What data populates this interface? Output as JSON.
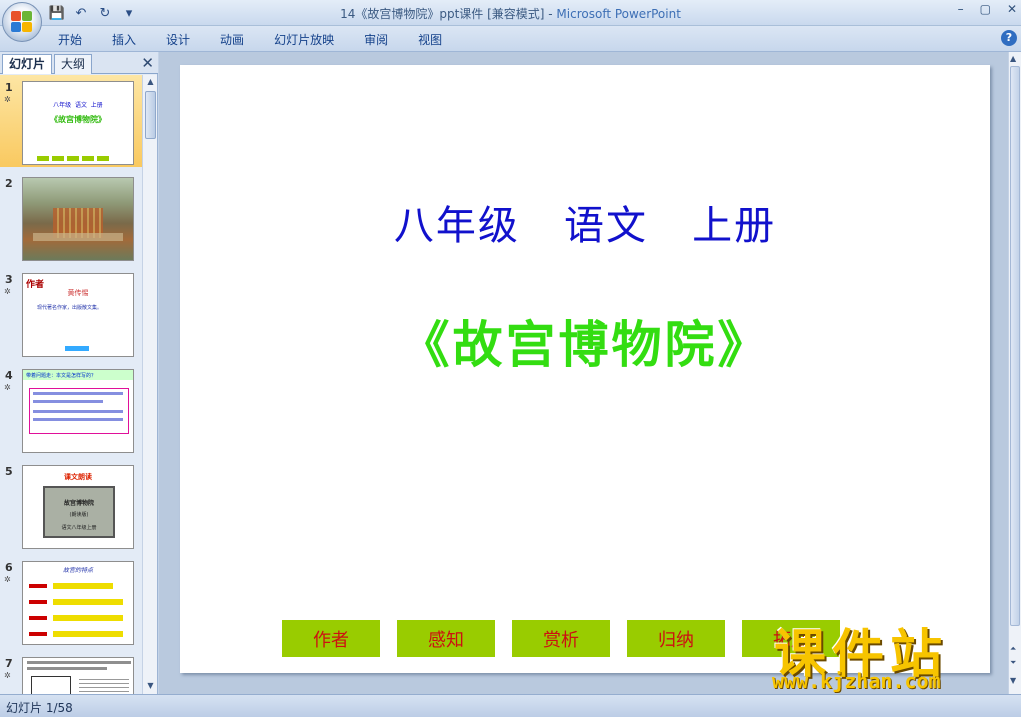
{
  "window": {
    "title": "14《故宫博物院》ppt课件 [兼容模式] - ",
    "app_name": "Microsoft PowerPoint",
    "minimize": "–",
    "maximize": "▢",
    "close": "✕"
  },
  "quick_access": {
    "save": "💾",
    "undo": "↶",
    "redo": "↻",
    "more": "▾"
  },
  "ribbon": {
    "tabs": [
      "开始",
      "插入",
      "设计",
      "动画",
      "幻灯片放映",
      "审阅",
      "视图"
    ],
    "help": "?"
  },
  "left_pane": {
    "tabs": [
      "幻灯片",
      "大纲"
    ],
    "close": "✕",
    "thumbnails": [
      {
        "num": "1",
        "selected": true,
        "line1": "八年级  语文  上册",
        "line2": "《故宫博物院》"
      },
      {
        "num": "2",
        "selected": false
      },
      {
        "num": "3",
        "selected": false,
        "heading": "作者",
        "sub": "黄传惕",
        "body": "现代著名作家，出版散文集。"
      },
      {
        "num": "4",
        "selected": false,
        "heading": "带着问题走：本文是怎样写的？"
      },
      {
        "num": "5",
        "selected": false,
        "heading": "课文朗读",
        "box1": "故宫博物院",
        "box2": "(朗读版)",
        "box3": "语文八年级上册"
      },
      {
        "num": "6",
        "selected": false,
        "heading": "故宫的特点"
      },
      {
        "num": "7",
        "selected": false
      }
    ]
  },
  "slide": {
    "line1": "八年级   语文   上册",
    "line2": "《故宫博物院》",
    "buttons": [
      "作者",
      "感知",
      "赏析",
      "归纳",
      "拓展"
    ]
  },
  "watermark": {
    "big": "课件站",
    "url": "www.kjzhan.com"
  },
  "status": {
    "text": "幻灯片 1/58"
  },
  "colors": {
    "title_blue": "#1111cc",
    "title_green": "#33dd11",
    "button_green": "#99cc00",
    "button_text": "#cc1111",
    "watermark": "#f7c400"
  }
}
